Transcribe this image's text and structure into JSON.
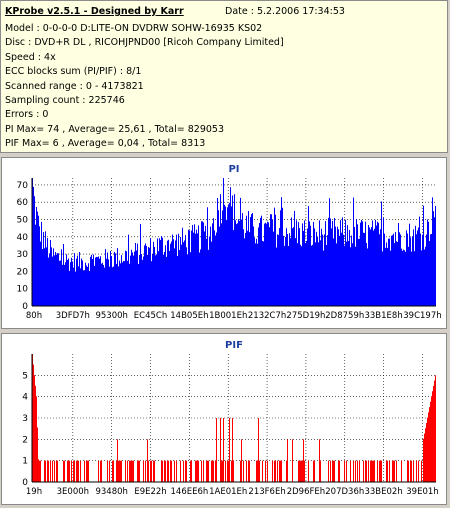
{
  "header": {
    "title": "KProbe v2.5.1 - Designed by Karr",
    "date": "Date : 5.2.2006 17:34:53",
    "lines": [
      "Model : 0-0-0-0 D:LITE-ON DVDRW SOHW-16935 KS02",
      "Disc : DVD+R DL , RICOHJPND00 [Ricoh Company Limited]",
      "Speed : 4x",
      "ECC blocks sum (PI/PIF) : 8/1",
      "Scanned range : 0 - 4173821",
      "Sampling count : 225746",
      "Errors : 0",
      "PI Max= 74 , Average= 25,61 , Total= 829053",
      "PIF Max= 6 , Average= 0,04 , Total= 8313"
    ]
  },
  "colors": {
    "pi": "#0000ff",
    "pif": "#ff0000",
    "title": "#2040a0"
  },
  "chart_data": [
    {
      "type": "bar",
      "title": "PI",
      "ylim": [
        0,
        74
      ],
      "yticks": [
        0,
        10,
        20,
        30,
        40,
        50,
        60,
        70
      ],
      "categories": [
        "80h",
        "3DFD7h",
        "95300h",
        "EC45Ch",
        "14B05Eh",
        "1B001Eh",
        "2132C7h",
        "275D19h",
        "2D8759h",
        "33B1E8h",
        "39C197h"
      ],
      "grid": true,
      "profile": [
        [
          0,
          73
        ],
        [
          0.005,
          60
        ],
        [
          0.015,
          47
        ],
        [
          0.03,
          38
        ],
        [
          0.05,
          30
        ],
        [
          0.08,
          27
        ],
        [
          0.12,
          26
        ],
        [
          0.16,
          27
        ],
        [
          0.22,
          29
        ],
        [
          0.27,
          32
        ],
        [
          0.32,
          36
        ],
        [
          0.37,
          38
        ],
        [
          0.41,
          40
        ],
        [
          0.44,
          43
        ],
        [
          0.455,
          52
        ],
        [
          0.47,
          64
        ],
        [
          0.475,
          70
        ],
        [
          0.49,
          60
        ],
        [
          0.51,
          52
        ],
        [
          0.53,
          47
        ],
        [
          0.56,
          44
        ],
        [
          0.6,
          45
        ],
        [
          0.65,
          44
        ],
        [
          0.7,
          42
        ],
        [
          0.75,
          43
        ],
        [
          0.8,
          43
        ],
        [
          0.85,
          42
        ],
        [
          0.9,
          42
        ],
        [
          0.95,
          41
        ],
        [
          0.98,
          44
        ],
        [
          1.0,
          60
        ]
      ]
    },
    {
      "type": "bar",
      "title": "PIF",
      "ylim": [
        0,
        6
      ],
      "yticks": [
        0,
        1,
        2,
        3,
        4,
        5
      ],
      "categories": [
        "19h",
        "3E000h",
        "93480h",
        "E9E22h",
        "146EE6h",
        "1AE01Eh",
        "213F6Eh",
        "2D96FEh",
        "207D36h",
        "33BE02h",
        "39E01h"
      ],
      "grid": true,
      "profile": [
        [
          0,
          6
        ],
        [
          0.005,
          5
        ],
        [
          0.01,
          4
        ],
        [
          0.015,
          1
        ],
        [
          0.05,
          1
        ],
        [
          0.3,
          1
        ],
        [
          0.45,
          1
        ],
        [
          0.47,
          3
        ],
        [
          0.5,
          2
        ],
        [
          0.6,
          2
        ],
        [
          0.75,
          1
        ],
        [
          0.9,
          1
        ],
        [
          0.97,
          2
        ],
        [
          0.99,
          4
        ],
        [
          1.0,
          5
        ]
      ]
    }
  ]
}
